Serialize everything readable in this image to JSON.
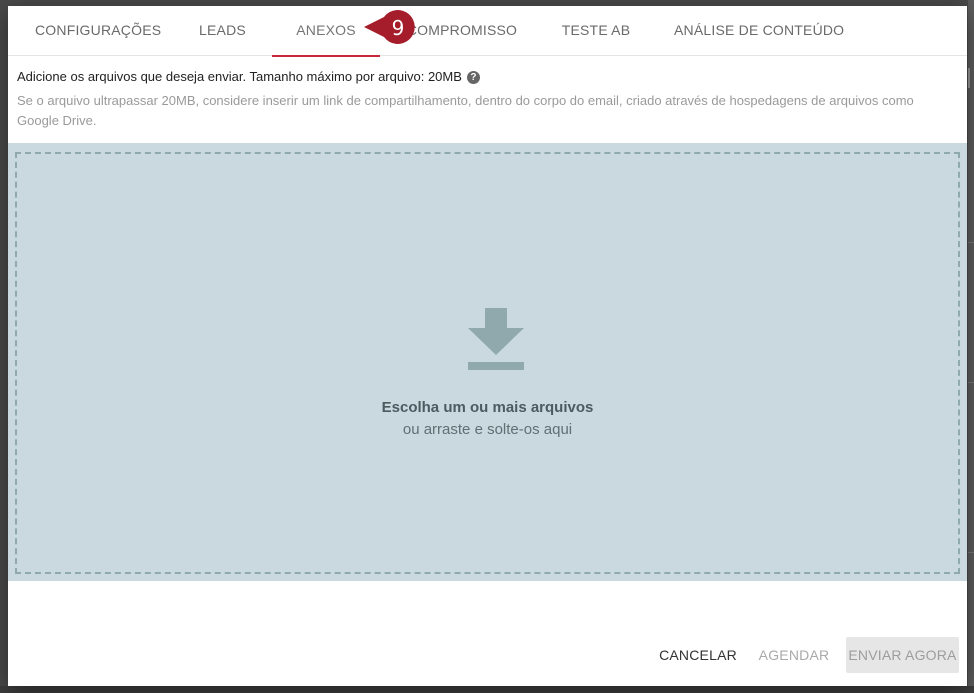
{
  "tabs": [
    {
      "label": "CONFIGURAÇÕES"
    },
    {
      "label": "LEADS"
    },
    {
      "label": "ANEXOS"
    },
    {
      "label": "COMPROMISSO"
    },
    {
      "label": "TESTE AB"
    },
    {
      "label": "ANÁLISE DE CONTEÚDO"
    }
  ],
  "active_tab": "ANEXOS",
  "step_marker": {
    "number": "9",
    "color": "#a51d2b"
  },
  "info": {
    "title": "Adicione os arquivos que deseja enviar. Tamanho máximo por arquivo: 20MB",
    "help_icon": "?",
    "subtitle": "Se o arquivo ultrapassar 20MB, considere inserir um link de compartilhamento, dentro do corpo do email, criado através de hospedagens de arquivos como Google Drive."
  },
  "dropzone": {
    "icon": "download-icon",
    "primary": "Escolha um ou mais arquivos",
    "secondary": "ou arraste e solte-os aqui"
  },
  "footer": {
    "cancel": "CANCELAR",
    "schedule": "AGENDAR",
    "send": "ENVIAR AGORA"
  },
  "colors": {
    "accent": "#c5293a",
    "dropzone_bg": "#c9d9df",
    "icon": "#8fa9ad"
  }
}
